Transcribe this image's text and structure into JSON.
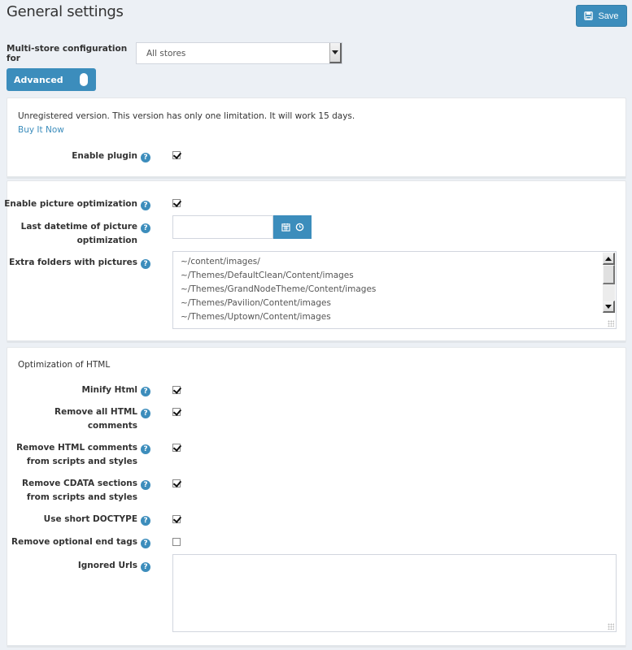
{
  "header": {
    "title": "General settings",
    "save_label": "Save",
    "save_icon": "floppy-disk-icon"
  },
  "store_config": {
    "label": "Multi-store configuration for",
    "selected": "All stores"
  },
  "advanced_toggle": {
    "label": "Advanced",
    "on": true
  },
  "license_panel": {
    "notice": "Unregistered version. This version has only one limitation. It will work 15 days.",
    "buy_link": "Buy It Now",
    "enable_plugin": {
      "label": "Enable plugin",
      "checked": true
    }
  },
  "picture_panel": {
    "enable_picture_optimization": {
      "label": "Enable picture optimization",
      "checked": true
    },
    "last_datetime": {
      "label_line1": "Last datetime of picture",
      "label_line2": "optimization",
      "value": "",
      "calendar_icon": "calendar-icon",
      "clock_icon": "clock-icon"
    },
    "extra_folders": {
      "label": "Extra folders with pictures",
      "lines": [
        "~/content/images/",
        "~/Themes/DefaultClean/Content/images",
        "~/Themes/GrandNodeTheme/Content/images",
        "~/Themes/Pavilion/Content/images",
        "~/Themes/Uptown/Content/images"
      ]
    }
  },
  "html_panel": {
    "title": "Optimization of HTML",
    "options": [
      {
        "label_line1": "Minify Html",
        "label_line2": "",
        "checked": true
      },
      {
        "label_line1": "Remove all HTML",
        "label_line2": "comments",
        "checked": true
      },
      {
        "label_line1": "Remove HTML comments",
        "label_line2": "from scripts and styles",
        "checked": true
      },
      {
        "label_line1": "Remove CDATA sections",
        "label_line2": "from scripts and styles",
        "checked": true
      },
      {
        "label_line1": "Use short DOCTYPE",
        "label_line2": "",
        "checked": true
      },
      {
        "label_line1": "Remove optional end tags",
        "label_line2": "",
        "checked": false
      }
    ],
    "ignored_urls": {
      "label": "Ignored Urls",
      "value": ""
    }
  },
  "help_glyph": "?",
  "colors": {
    "accent": "#3c8dbc",
    "background": "#ecf0f5",
    "panel": "#ffffff"
  }
}
